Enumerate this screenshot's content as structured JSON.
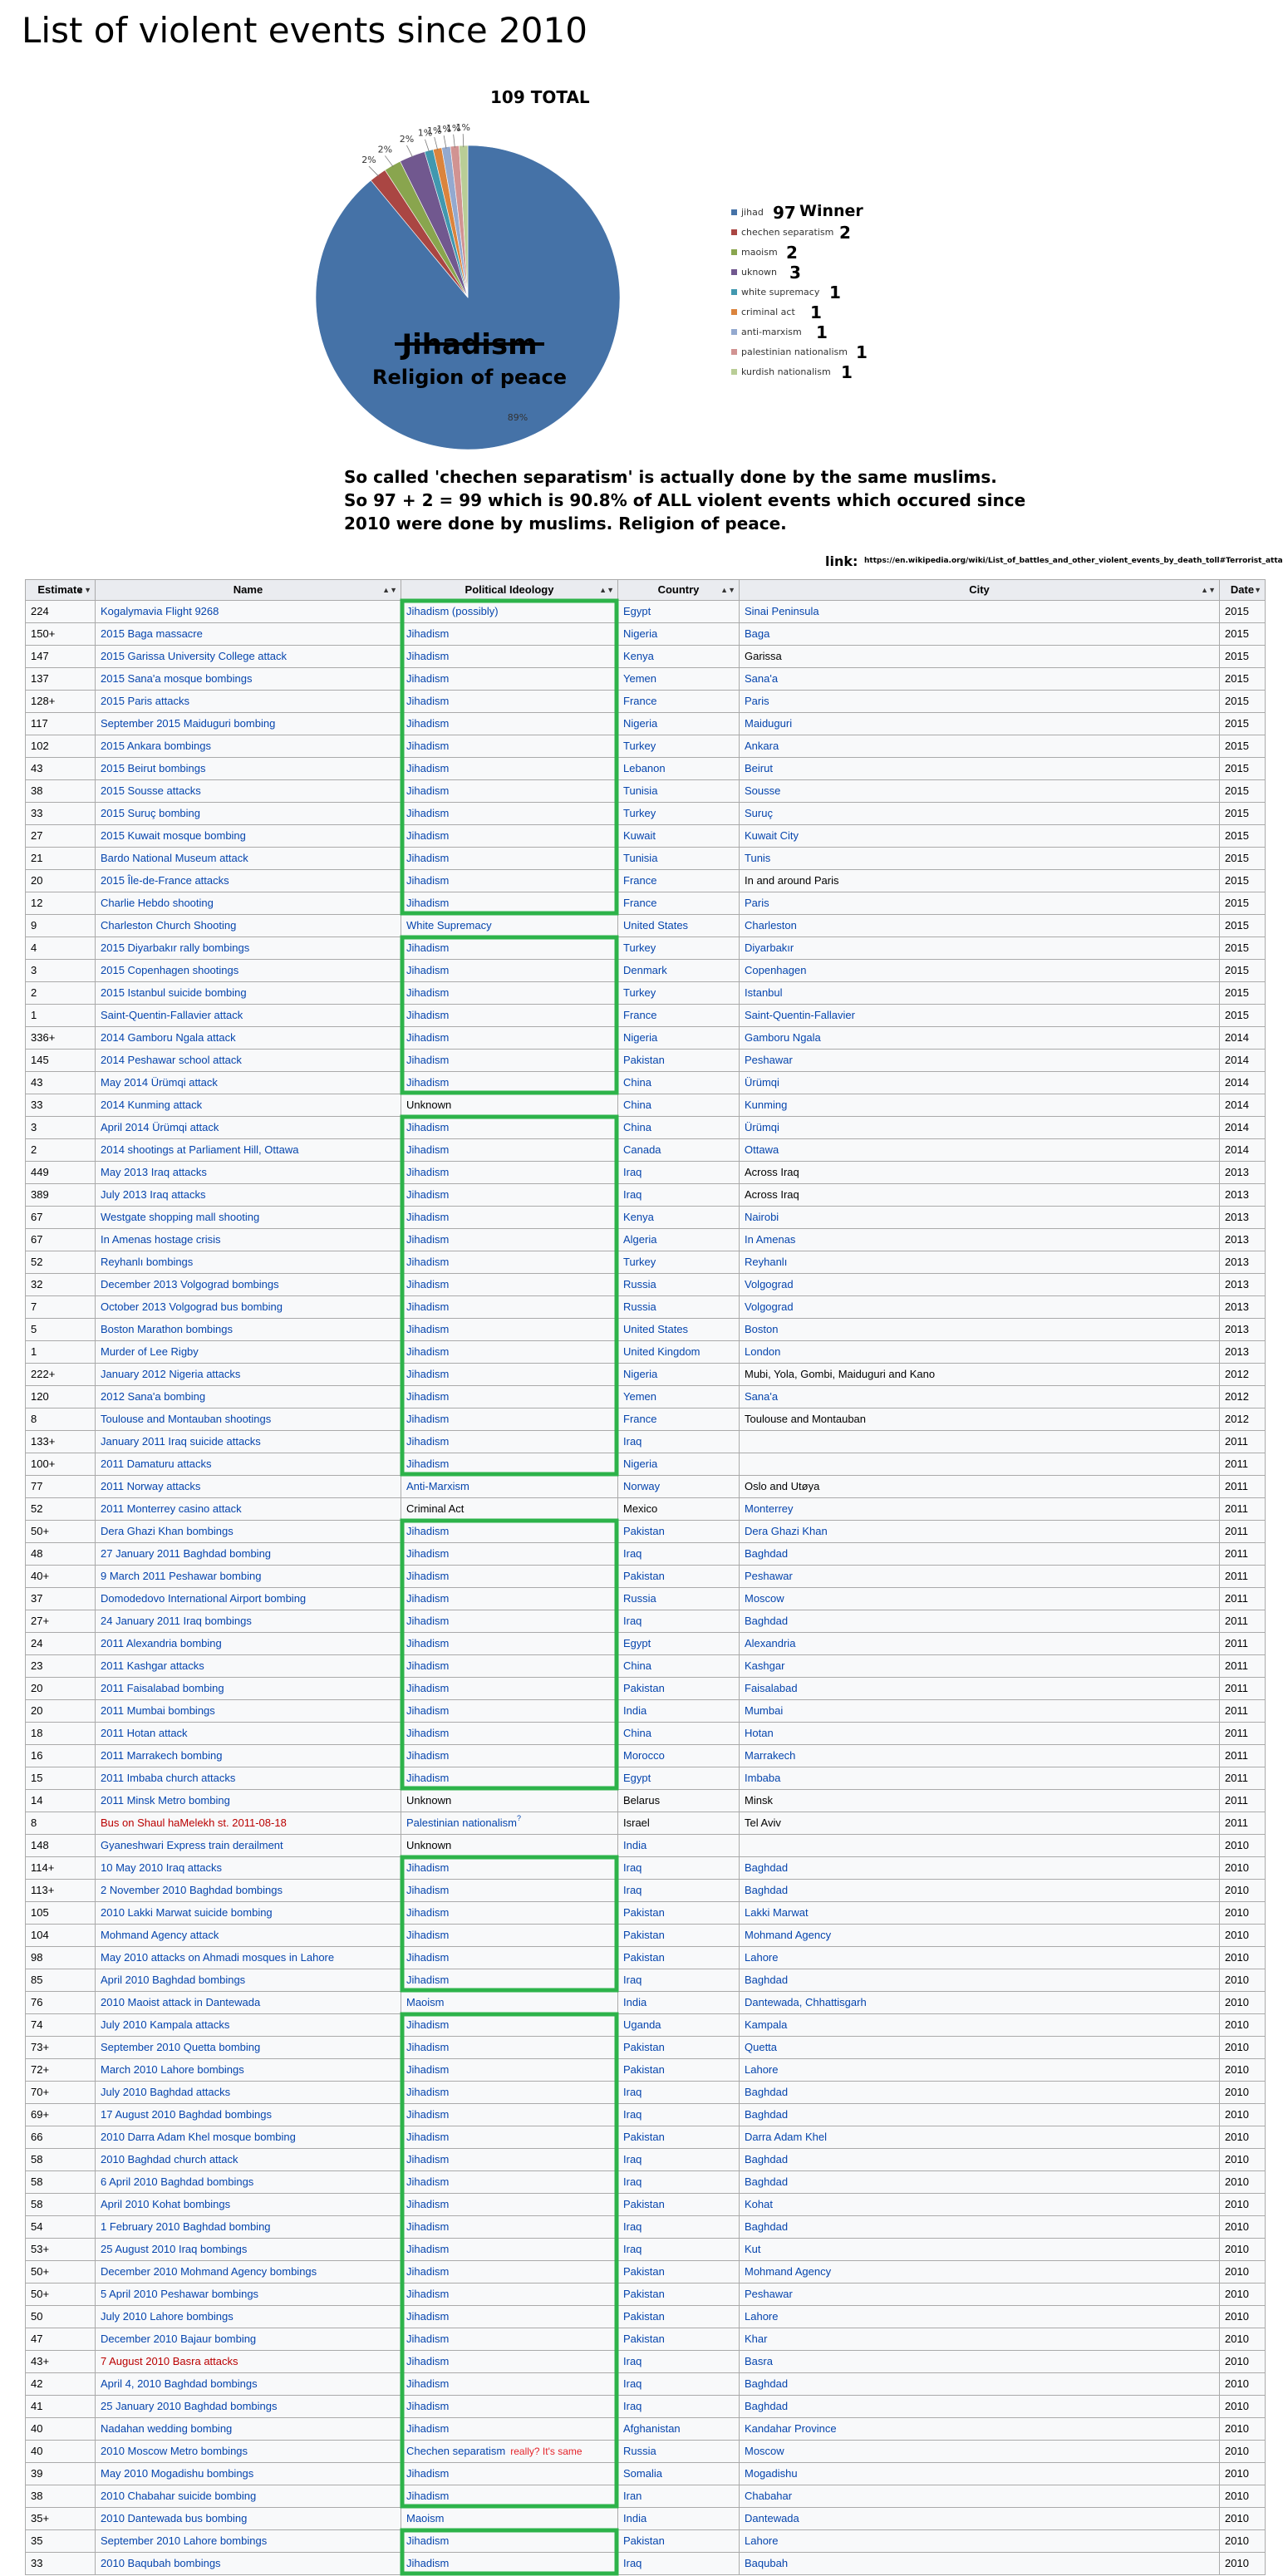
{
  "page": {
    "title": "List of violent events since 2010",
    "caption": [
      "So called 'chechen separatism' is actually done by the same muslims.",
      "So 97 + 2 = 99 which is 90.8% of ALL violent events which occured since",
      "2010 were done by muslims. Religion of peace."
    ],
    "link_label": "link:",
    "link_url": "https://en.wikipedia.org/wiki/List_of_battles_and_other_violent_events_by_death_toll#Terrorist_attacks",
    "annotation_note": "really? It's same",
    "colors": {
      "box": "#2db34a",
      "link": "#0645ad",
      "red": "#ba0000"
    }
  },
  "chart_data": {
    "type": "pie",
    "total_label": "109 TOTAL",
    "overlay_struck": "Jihadism",
    "overlay_text": "Religion of peace",
    "winner_label": "Winner",
    "slices": [
      {
        "name": "jihad",
        "value": 97,
        "percent_label": "89%",
        "color": "#4572a7"
      },
      {
        "name": "chechen separatism",
        "value": 2,
        "percent_label": "2%",
        "color": "#aa4643"
      },
      {
        "name": "maoism",
        "value": 2,
        "percent_label": "2%",
        "color": "#89a54e"
      },
      {
        "name": "uknown",
        "value": 3,
        "percent_label": "2%",
        "color": "#71588f"
      },
      {
        "name": "white supremacy",
        "value": 1,
        "percent_label": "1%",
        "color": "#4198af"
      },
      {
        "name": "criminal act",
        "value": 1,
        "percent_label": "1%",
        "color": "#db843d"
      },
      {
        "name": "anti-marxism",
        "value": 1,
        "percent_label": "1%",
        "color": "#93a9cf"
      },
      {
        "name": "palestinian nationalism",
        "value": 1,
        "percent_label": "1%",
        "color": "#d19392"
      },
      {
        "name": "kurdish nationalism",
        "value": 1,
        "percent_label": "1%",
        "color": "#b9cd96"
      }
    ]
  },
  "table": {
    "headers": [
      "Estimate",
      "Name",
      "Political Ideology",
      "Country",
      "City",
      "Date"
    ],
    "rows": [
      [
        "224",
        "Kogalymavia Flight 9268",
        "Jihadism (possibly)",
        "Egypt",
        "Sinai Peninsula",
        "2015"
      ],
      [
        "150+",
        "2015 Baga massacre",
        "Jihadism",
        "Nigeria",
        "Baga",
        "2015"
      ],
      [
        "147",
        "2015 Garissa University College attack",
        "Jihadism",
        "Kenya",
        "Garissa",
        "2015"
      ],
      [
        "137",
        "2015 Sana'a mosque bombings",
        "Jihadism",
        "Yemen",
        "Sana'a",
        "2015"
      ],
      [
        "128+",
        "2015 Paris attacks",
        "Jihadism",
        "France",
        "Paris",
        "2015"
      ],
      [
        "117",
        "September 2015 Maiduguri bombing",
        "Jihadism",
        "Nigeria",
        "Maiduguri",
        "2015"
      ],
      [
        "102",
        "2015 Ankara bombings",
        "Jihadism",
        "Turkey",
        "Ankara",
        "2015"
      ],
      [
        "43",
        "2015 Beirut bombings",
        "Jihadism",
        "Lebanon",
        "Beirut",
        "2015"
      ],
      [
        "38",
        "2015 Sousse attacks",
        "Jihadism",
        "Tunisia",
        "Sousse",
        "2015"
      ],
      [
        "33",
        "2015 Suruç bombing",
        "Jihadism",
        "Turkey",
        "Suruç",
        "2015"
      ],
      [
        "27",
        "2015 Kuwait mosque bombing",
        "Jihadism",
        "Kuwait",
        "Kuwait City",
        "2015"
      ],
      [
        "21",
        "Bardo National Museum attack",
        "Jihadism",
        "Tunisia",
        "Tunis",
        "2015"
      ],
      [
        "20",
        "2015 Île-de-France attacks",
        "Jihadism",
        "France",
        "In and around Paris",
        "2015"
      ],
      [
        "12",
        "Charlie Hebdo shooting",
        "Jihadism",
        "France",
        "Paris",
        "2015"
      ],
      [
        "9",
        "Charleston Church Shooting",
        "White Supremacy",
        "United States",
        "Charleston",
        "2015"
      ],
      [
        "4",
        "2015 Diyarbakır rally bombings",
        "Jihadism",
        "Turkey",
        "Diyarbakır",
        "2015"
      ],
      [
        "3",
        "2015 Copenhagen shootings",
        "Jihadism",
        "Denmark",
        "Copenhagen",
        "2015"
      ],
      [
        "2",
        "2015 Istanbul suicide bombing",
        "Jihadism",
        "Turkey",
        "Istanbul",
        "2015"
      ],
      [
        "1",
        "Saint-Quentin-Fallavier attack",
        "Jihadism",
        "France",
        "Saint-Quentin-Fallavier",
        "2015"
      ],
      [
        "336+",
        "2014 Gamboru Ngala attack",
        "Jihadism",
        "Nigeria",
        "Gamboru Ngala",
        "2014"
      ],
      [
        "145",
        "2014 Peshawar school attack",
        "Jihadism",
        "Pakistan",
        "Peshawar",
        "2014"
      ],
      [
        "43",
        "May 2014 Ürümqi attack",
        "Jihadism",
        "China",
        "Ürümqi",
        "2014"
      ],
      [
        "33",
        "2014 Kunming attack",
        "Unknown",
        "China",
        "Kunming",
        "2014"
      ],
      [
        "3",
        "April 2014 Ürümqi attack",
        "Jihadism",
        "China",
        "Ürümqi",
        "2014"
      ],
      [
        "2",
        "2014 shootings at Parliament Hill, Ottawa",
        "Jihadism",
        "Canada",
        "Ottawa",
        "2014"
      ],
      [
        "449",
        "May 2013 Iraq attacks",
        "Jihadism",
        "Iraq",
        "Across Iraq",
        "2013"
      ],
      [
        "389",
        "July 2013 Iraq attacks",
        "Jihadism",
        "Iraq",
        "Across Iraq",
        "2013"
      ],
      [
        "67",
        "Westgate shopping mall shooting",
        "Jihadism",
        "Kenya",
        "Nairobi",
        "2013"
      ],
      [
        "67",
        "In Amenas hostage crisis",
        "Jihadism",
        "Algeria",
        "In Amenas",
        "2013"
      ],
      [
        "52",
        "Reyhanlı bombings",
        "Jihadism",
        "Turkey",
        "Reyhanlı",
        "2013"
      ],
      [
        "32",
        "December 2013 Volgograd bombings",
        "Jihadism",
        "Russia",
        "Volgograd",
        "2013"
      ],
      [
        "7",
        "October 2013 Volgograd bus bombing",
        "Jihadism",
        "Russia",
        "Volgograd",
        "2013"
      ],
      [
        "5",
        "Boston Marathon bombings",
        "Jihadism",
        "United States",
        "Boston",
        "2013"
      ],
      [
        "1",
        "Murder of Lee Rigby",
        "Jihadism",
        "United Kingdom",
        "London",
        "2013"
      ],
      [
        "222+",
        "January 2012 Nigeria attacks",
        "Jihadism",
        "Nigeria",
        "Mubi, Yola, Gombi, Maiduguri and Kano",
        "2012"
      ],
      [
        "120",
        "2012 Sana'a bombing",
        "Jihadism",
        "Yemen",
        "Sana'a",
        "2012"
      ],
      [
        "8",
        "Toulouse and Montauban shootings",
        "Jihadism",
        "France",
        "Toulouse and Montauban",
        "2012"
      ],
      [
        "133+",
        "January 2011 Iraq suicide attacks",
        "Jihadism",
        "Iraq",
        "",
        "2011"
      ],
      [
        "100+",
        "2011 Damaturu attacks",
        "Jihadism",
        "Nigeria",
        "",
        "2011"
      ],
      [
        "77",
        "2011 Norway attacks",
        "Anti-Marxism",
        "Norway",
        "Oslo and Utøya",
        "2011"
      ],
      [
        "52",
        "2011 Monterrey casino attack",
        "Criminal Act",
        "Mexico",
        "Monterrey",
        "2011"
      ],
      [
        "50+",
        "Dera Ghazi Khan bombings",
        "Jihadism",
        "Pakistan",
        "Dera Ghazi Khan",
        "2011"
      ],
      [
        "48",
        "27 January 2011 Baghdad bombing",
        "Jihadism",
        "Iraq",
        "Baghdad",
        "2011"
      ],
      [
        "40+",
        "9 March 2011 Peshawar bombing",
        "Jihadism",
        "Pakistan",
        "Peshawar",
        "2011"
      ],
      [
        "37",
        "Domodedovo International Airport bombing",
        "Jihadism",
        "Russia",
        "Moscow",
        "2011"
      ],
      [
        "27+",
        "24 January 2011 Iraq bombings",
        "Jihadism",
        "Iraq",
        "Baghdad",
        "2011"
      ],
      [
        "24",
        "2011 Alexandria bombing",
        "Jihadism",
        "Egypt",
        "Alexandria",
        "2011"
      ],
      [
        "23",
        "2011 Kashgar attacks",
        "Jihadism",
        "China",
        "Kashgar",
        "2011"
      ],
      [
        "20",
        "2011 Faisalabad bombing",
        "Jihadism",
        "Pakistan",
        "Faisalabad",
        "2011"
      ],
      [
        "20",
        "2011 Mumbai bombings",
        "Jihadism",
        "India",
        "Mumbai",
        "2011"
      ],
      [
        "18",
        "2011 Hotan attack",
        "Jihadism",
        "China",
        "Hotan",
        "2011"
      ],
      [
        "16",
        "2011 Marrakech bombing",
        "Jihadism",
        "Morocco",
        "Marrakech",
        "2011"
      ],
      [
        "15",
        "2011 Imbaba church attacks",
        "Jihadism",
        "Egypt",
        "Imbaba",
        "2011"
      ],
      [
        "14",
        "2011 Minsk Metro bombing",
        "Unknown",
        "Belarus",
        "Minsk",
        "2011"
      ],
      [
        "8",
        "Bus on Shaul haMelekh st. 2011-08-18",
        "Palestinian nationalism",
        "Israel",
        "Tel Aviv",
        "2011"
      ],
      [
        "148",
        "Gyaneshwari Express train derailment",
        "Unknown",
        "India",
        "",
        "2010"
      ],
      [
        "114+",
        "10 May 2010 Iraq attacks",
        "Jihadism",
        "Iraq",
        "Baghdad",
        "2010"
      ],
      [
        "113+",
        "2 November 2010 Baghdad bombings",
        "Jihadism",
        "Iraq",
        "Baghdad",
        "2010"
      ],
      [
        "105",
        "2010 Lakki Marwat suicide bombing",
        "Jihadism",
        "Pakistan",
        "Lakki Marwat",
        "2010"
      ],
      [
        "104",
        "Mohmand Agency attack",
        "Jihadism",
        "Pakistan",
        "Mohmand Agency",
        "2010"
      ],
      [
        "98",
        "May 2010 attacks on Ahmadi mosques in Lahore",
        "Jihadism",
        "Pakistan",
        "Lahore",
        "2010"
      ],
      [
        "85",
        "April 2010 Baghdad bombings",
        "Jihadism",
        "Iraq",
        "Baghdad",
        "2010"
      ],
      [
        "76",
        "2010 Maoist attack in Dantewada",
        "Maoism",
        "India",
        "Dantewada, Chhattisgarh",
        "2010"
      ],
      [
        "74",
        "July 2010 Kampala attacks",
        "Jihadism",
        "Uganda",
        "Kampala",
        "2010"
      ],
      [
        "73+",
        "September 2010 Quetta bombing",
        "Jihadism",
        "Pakistan",
        "Quetta",
        "2010"
      ],
      [
        "72+",
        "March 2010 Lahore bombings",
        "Jihadism",
        "Pakistan",
        "Lahore",
        "2010"
      ],
      [
        "70+",
        "July 2010 Baghdad attacks",
        "Jihadism",
        "Iraq",
        "Baghdad",
        "2010"
      ],
      [
        "69+",
        "17 August 2010 Baghdad bombings",
        "Jihadism",
        "Iraq",
        "Baghdad",
        "2010"
      ],
      [
        "66",
        "2010 Darra Adam Khel mosque bombing",
        "Jihadism",
        "Pakistan",
        "Darra Adam Khel",
        "2010"
      ],
      [
        "58",
        "2010 Baghdad church attack",
        "Jihadism",
        "Iraq",
        "Baghdad",
        "2010"
      ],
      [
        "58",
        "6 April 2010 Baghdad bombings",
        "Jihadism",
        "Iraq",
        "Baghdad",
        "2010"
      ],
      [
        "58",
        "April 2010 Kohat bombings",
        "Jihadism",
        "Pakistan",
        "Kohat",
        "2010"
      ],
      [
        "54",
        "1 February 2010 Baghdad bombing",
        "Jihadism",
        "Iraq",
        "Baghdad",
        "2010"
      ],
      [
        "53+",
        "25 August 2010 Iraq bombings",
        "Jihadism",
        "Iraq",
        "Kut",
        "2010"
      ],
      [
        "50+",
        "December 2010 Mohmand Agency bombings",
        "Jihadism",
        "Pakistan",
        "Mohmand Agency",
        "2010"
      ],
      [
        "50+",
        "5 April 2010 Peshawar bombings",
        "Jihadism",
        "Pakistan",
        "Peshawar",
        "2010"
      ],
      [
        "50",
        "July 2010 Lahore bombings",
        "Jihadism",
        "Pakistan",
        "Lahore",
        "2010"
      ],
      [
        "47",
        "December 2010 Bajaur bombing",
        "Jihadism",
        "Pakistan",
        "Khar",
        "2010"
      ],
      [
        "43+",
        "7 August 2010 Basra attacks",
        "Jihadism",
        "Iraq",
        "Basra",
        "2010"
      ],
      [
        "42",
        "April 4, 2010 Baghdad bombings",
        "Jihadism",
        "Iraq",
        "Baghdad",
        "2010"
      ],
      [
        "41",
        "25 January 2010 Baghdad bombings",
        "Jihadism",
        "Iraq",
        "Baghdad",
        "2010"
      ],
      [
        "40",
        "Nadahan wedding bombing",
        "Jihadism",
        "Afghanistan",
        "Kandahar Province",
        "2010"
      ],
      [
        "40",
        "2010 Moscow Metro bombings",
        "Chechen separatism",
        "Russia",
        "Moscow",
        "2010"
      ],
      [
        "39",
        "May 2010 Mogadishu bombings",
        "Jihadism",
        "Somalia",
        "Mogadishu",
        "2010"
      ],
      [
        "38",
        "2010 Chabahar suicide bombing",
        "Jihadism",
        "Iran",
        "Chabahar",
        "2010"
      ],
      [
        "35+",
        "2010 Dantewada bus bombing",
        "Maoism",
        "India",
        "Dantewada",
        "2010"
      ],
      [
        "35",
        "September 2010 Lahore bombings",
        "Jihadism",
        "Pakistan",
        "Lahore",
        "2010"
      ],
      [
        "33",
        "2010 Baqubah bombings",
        "Jihadism",
        "Iraq",
        "Baqubah",
        "2010"
      ]
    ]
  }
}
